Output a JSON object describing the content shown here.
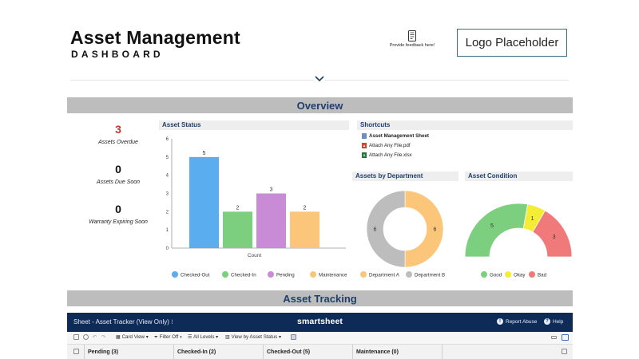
{
  "header": {
    "title": "Asset Management",
    "subtitle": "DASHBOARD",
    "feedback_text": "Provide feedback here!",
    "logo_text": "Logo Placeholder"
  },
  "sections": {
    "overview": "Overview",
    "tracking": "Asset Tracking"
  },
  "stats": [
    {
      "value": "3",
      "label": "Assets Overdue"
    },
    {
      "value": "0",
      "label": "Assets Due Soon"
    },
    {
      "value": "0",
      "label": "Warranty Expiring Soon"
    }
  ],
  "widgets": {
    "asset_status": "Asset Status",
    "shortcuts": "Shortcuts",
    "by_department": "Assets by Department",
    "condition": "Asset Condition"
  },
  "shortcuts": [
    {
      "label": "Asset Management Sheet",
      "icon": "sheet-icon",
      "color": "#6a8fc7"
    },
    {
      "label": "Attach Any File.pdf",
      "icon": "pdf-icon",
      "color": "#d9412f"
    },
    {
      "label": "Attach Any File.xlsx",
      "icon": "excel-icon",
      "color": "#1e7a3c"
    }
  ],
  "chart_data": [
    {
      "type": "bar",
      "title": "Asset Status",
      "categories": [
        "Checked-Out",
        "Checked-In",
        "Pending",
        "Maintenance"
      ],
      "values": [
        5,
        2,
        3,
        2
      ],
      "colors": [
        "#5aaeef",
        "#7bcf7f",
        "#c98bd6",
        "#fbc67a"
      ],
      "xlabel": "Count",
      "ylim": [
        0,
        6
      ],
      "yticks": [
        "0",
        "1",
        "2",
        "3",
        "4",
        "5",
        "6"
      ],
      "grid": false,
      "legend": "bottom"
    },
    {
      "type": "pie",
      "title": "Assets by Department",
      "donut": true,
      "labels": [
        "Department A",
        "Department B"
      ],
      "values": [
        6,
        6
      ],
      "colors": [
        "#fbc67a",
        "#bdbdbd"
      ],
      "legend": "bottom"
    },
    {
      "type": "pie",
      "title": "Asset Condition",
      "gauge": true,
      "labels": [
        "Good",
        "Okay",
        "Bad"
      ],
      "values": [
        5,
        1,
        3
      ],
      "colors": [
        "#7bcf7f",
        "#f4ec35",
        "#f07a7a"
      ],
      "legend": "bottom"
    }
  ],
  "tracker": {
    "title": "Sheet - Asset Tracker (View Only)",
    "title_suffix": "⁝",
    "brand": "smartsheet",
    "report_abuse": "Report Abuse",
    "help": "Help",
    "toolbar": {
      "card_view": "Card View ▾",
      "filter": "Filter Off ▾",
      "levels": "All Levels ▾",
      "view_by": "View by Asset Status ▾"
    },
    "columns": [
      "Pending (3)",
      "Checked-In (2)",
      "Checked-Out (5)",
      "Maintenance (0)"
    ]
  }
}
